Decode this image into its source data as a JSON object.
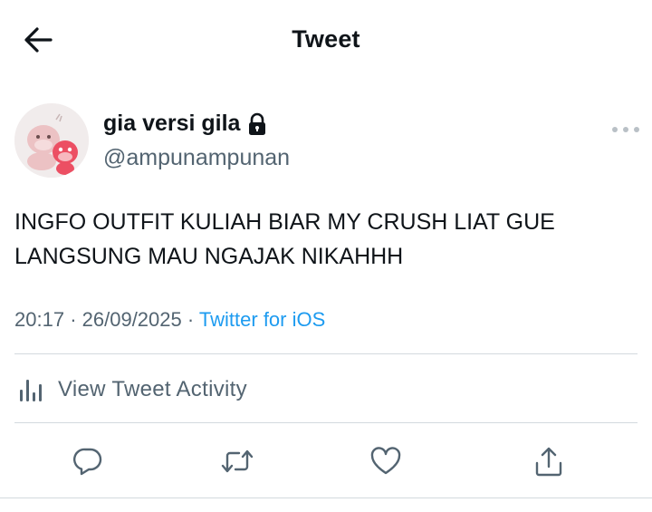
{
  "header": {
    "title": "Tweet",
    "back_icon": "arrow-left-icon"
  },
  "author": {
    "display_name": "gia versi gila",
    "handle": "@ampunampunan",
    "protected_icon": "lock-icon",
    "avatar_icon": "avatar-image"
  },
  "tweet": {
    "text": "INGFO OUTFIT KULIAH BIAR MY CRUSH LIAT GUE LANGSUNG MAU NGAJAK NIKAHHH",
    "time": "20:17",
    "date": "26/09/2025",
    "separator": "·",
    "source": "Twitter for iOS"
  },
  "activity": {
    "label": "View Tweet Activity",
    "icon": "bar-chart-icon"
  },
  "actions": {
    "reply_icon": "reply-icon",
    "retweet_icon": "retweet-icon",
    "like_icon": "heart-icon",
    "share_icon": "share-icon"
  },
  "colors": {
    "text": "#0f1419",
    "secondary": "#536471",
    "link": "#1d9bf0",
    "divider": "#d3d9de"
  }
}
